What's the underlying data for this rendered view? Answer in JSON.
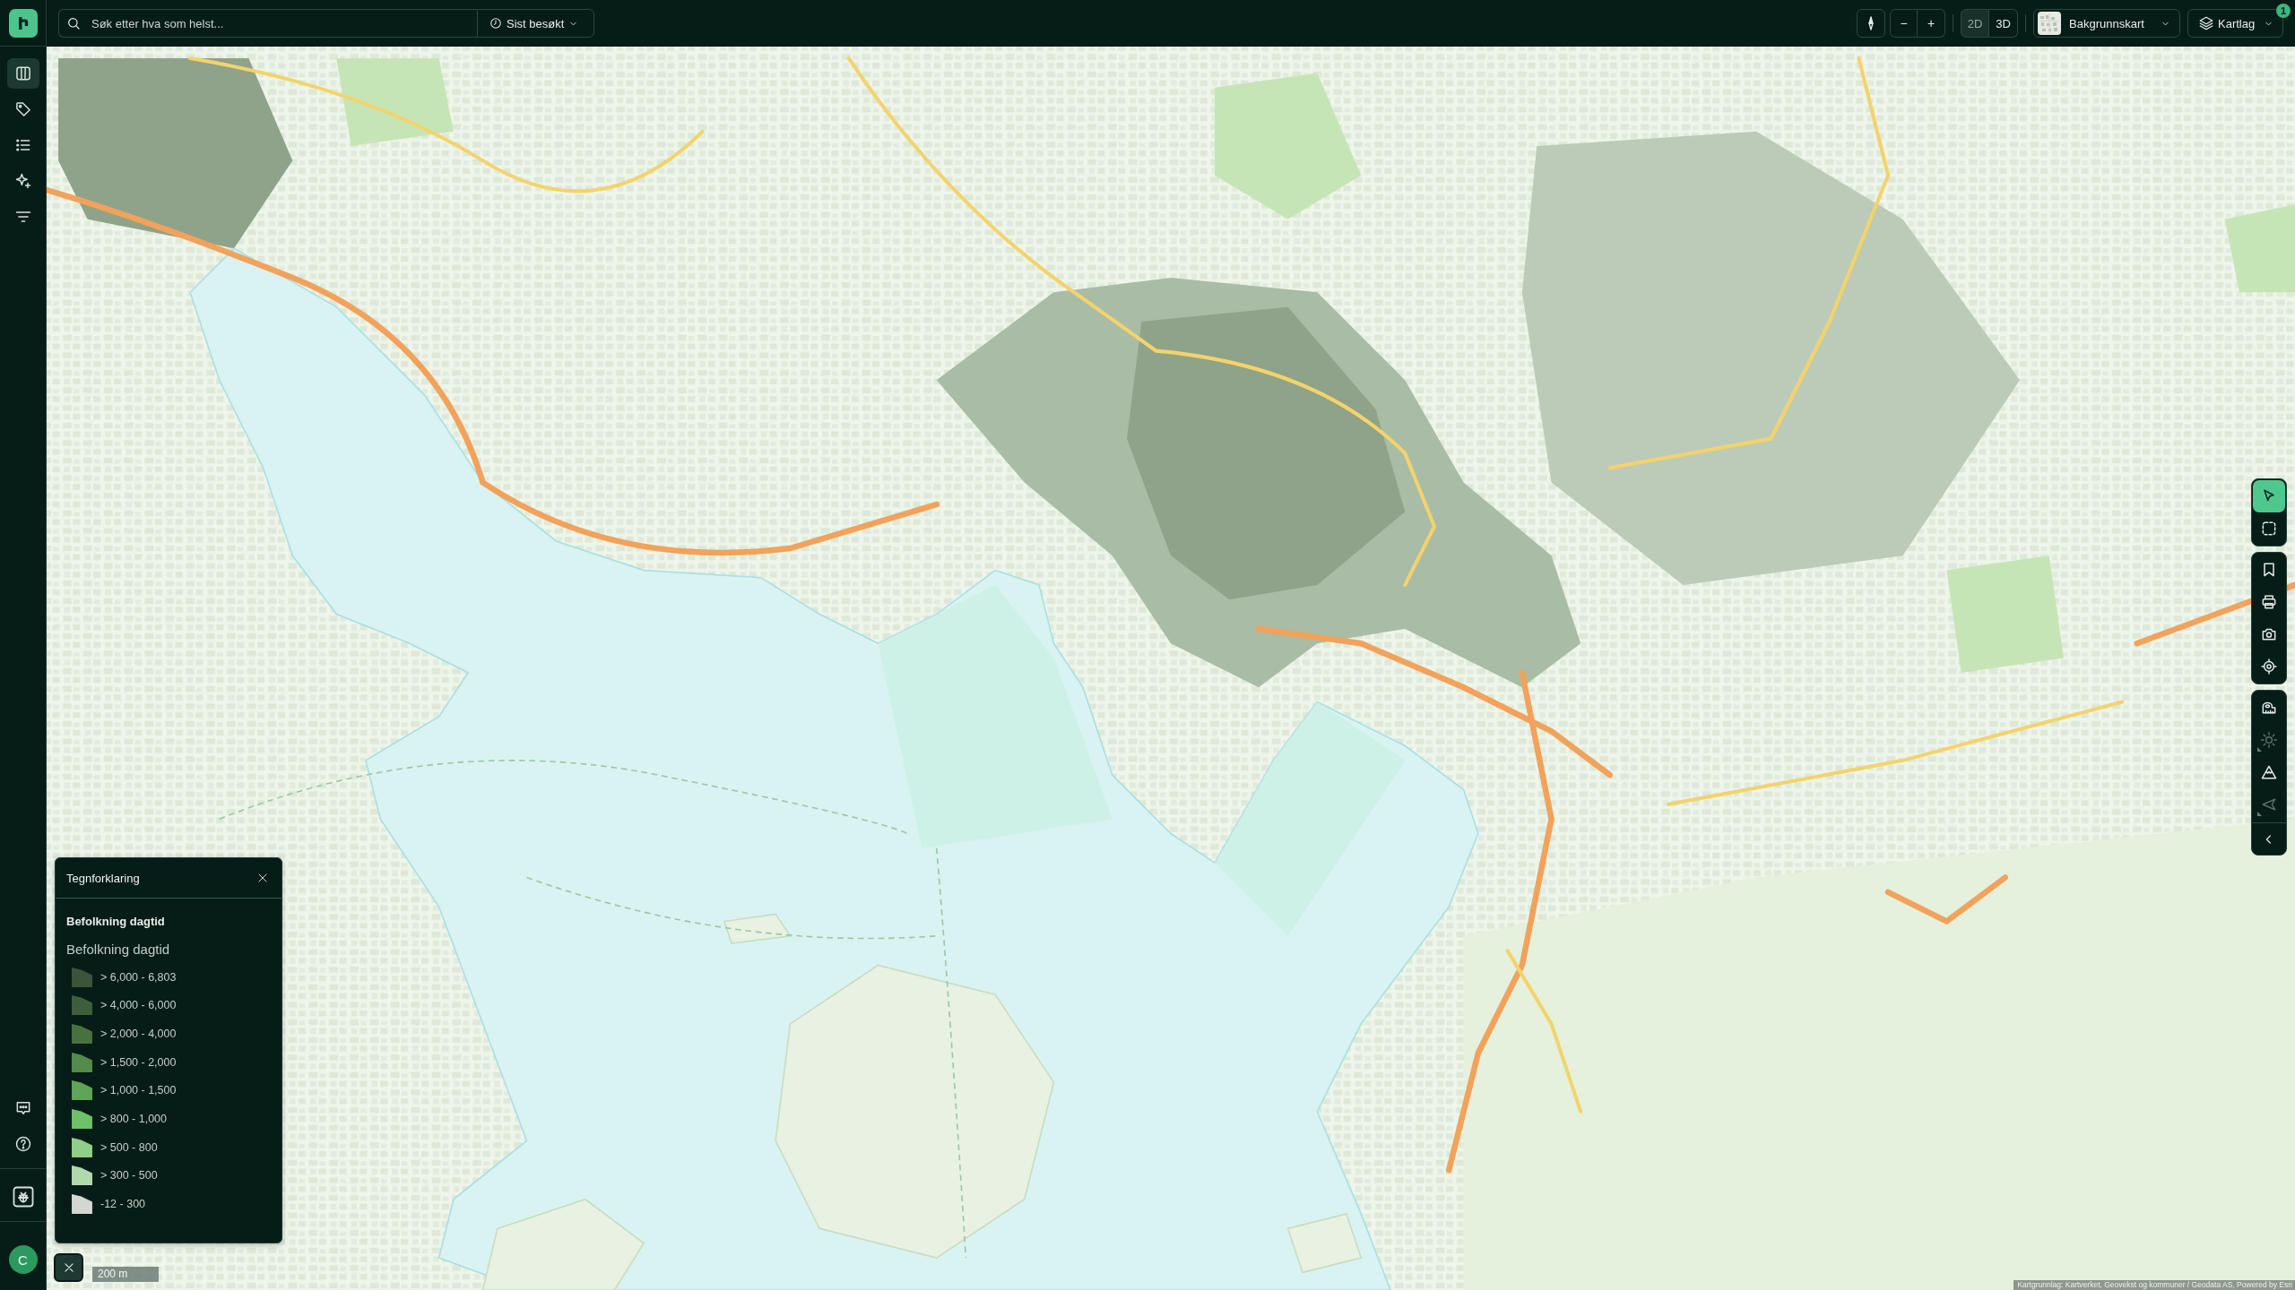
{
  "top_bar": {
    "search": {
      "placeholder": "Søk etter hva som helst..."
    },
    "recent": {
      "label": "Sist besøkt"
    },
    "zoom_buttons": [
      "−",
      "+"
    ],
    "view_modes": [
      {
        "label": "2D",
        "selected": true
      },
      {
        "label": "3D",
        "selected": false
      }
    ],
    "basemap": {
      "label": "Bakgrunnskart"
    },
    "layers": {
      "label": "Kartlag",
      "badge": "1"
    }
  },
  "sidebar": {
    "items": [
      {
        "selected": true
      },
      {
        "selected": false
      },
      {
        "selected": false
      },
      {
        "selected": false
      },
      {
        "selected": false
      }
    ],
    "user": {
      "initial": "C"
    }
  },
  "map_tools": {
    "groups": [
      {
        "tools": [
          {
            "selected": true,
            "disabled": false,
            "has_menu": false
          },
          {
            "selected": false,
            "disabled": false,
            "has_menu": false
          }
        ]
      },
      {
        "tools": [
          {
            "selected": false,
            "disabled": false,
            "has_menu": false
          },
          {
            "selected": false,
            "disabled": false,
            "has_menu": false
          },
          {
            "selected": false,
            "disabled": false,
            "has_menu": false
          },
          {
            "selected": false,
            "disabled": false,
            "has_menu": false
          }
        ]
      },
      {
        "tools": [
          {
            "selected": false,
            "disabled": false,
            "has_menu": false
          },
          {
            "selected": false,
            "disabled": true,
            "has_menu": true
          },
          {
            "selected": false,
            "disabled": false,
            "has_menu": false
          },
          {
            "selected": false,
            "disabled": true,
            "has_menu": true
          }
        ]
      }
    ]
  },
  "legend": {
    "title": "Tegnforklaring",
    "layer_title": "Befolkning dagtid",
    "subtitle": "Befolkning dagtid",
    "entries": [
      {
        "label": "> 6,000 - 6,803",
        "color": "#3c5438"
      },
      {
        "label": "> 4,000 - 6,000",
        "color": "#3e5f3b"
      },
      {
        "label": "> 2,000 - 4,000",
        "color": "#47713f"
      },
      {
        "label": "> 1,500 - 2,000",
        "color": "#548a4b"
      },
      {
        "label": "> 1,000 - 1,500",
        "color": "#5fa557"
      },
      {
        "label": "> 800 - 1,000",
        "color": "#6cc169"
      },
      {
        "label": "> 500 - 800",
        "color": "#8fcf88"
      },
      {
        "label": "> 300 - 500",
        "color": "#b2d8ae"
      },
      {
        "label": "-12 - 300",
        "color": "#d3d6d1"
      }
    ]
  },
  "scale_bar": {
    "label": "200 m"
  },
  "attribution": "Kartgrunnlag: Kartverket, Geovekst og kommuner / Geodata AS, Powered by Esri"
}
